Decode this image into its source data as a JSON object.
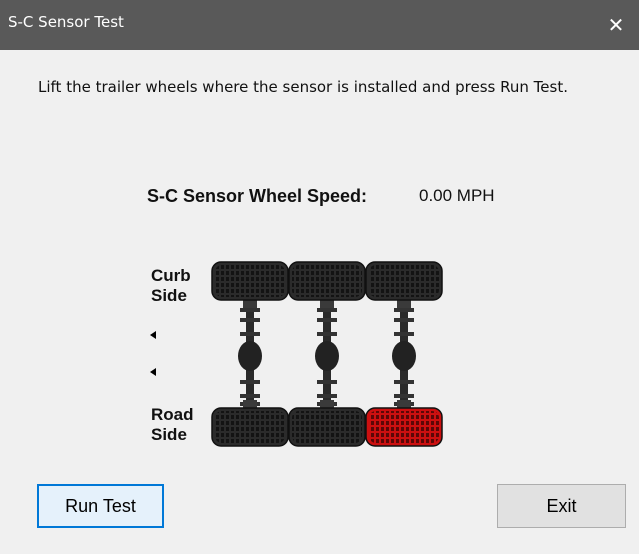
{
  "window": {
    "title": "S-C Sensor Test",
    "close_glyph": "✕"
  },
  "instruction": "Lift the trailer wheels where the sensor is installed and press Run Test.",
  "speed": {
    "label": "S-C Sensor Wheel Speed:",
    "value": "0.00 MPH"
  },
  "sides": {
    "curb_line1": "Curb",
    "curb_line2": "Side",
    "road_line1": "Road",
    "road_line2": "Side"
  },
  "axles": [
    {
      "name": "axle-1",
      "curb_tire_color": "#2b2b2b",
      "road_tire_color": "#2b2b2b"
    },
    {
      "name": "axle-2",
      "curb_tire_color": "#2b2b2b",
      "road_tire_color": "#2b2b2b"
    },
    {
      "name": "axle-3",
      "curb_tire_color": "#2b2b2b",
      "road_tire_color": "#cc1010"
    }
  ],
  "buttons": {
    "run_test": "Run Test",
    "exit": "Exit"
  },
  "colors": {
    "titlebar": "#595959",
    "background": "#f0f0f0",
    "focus_border": "#0078d7",
    "highlight_tire": "#cc1010"
  }
}
